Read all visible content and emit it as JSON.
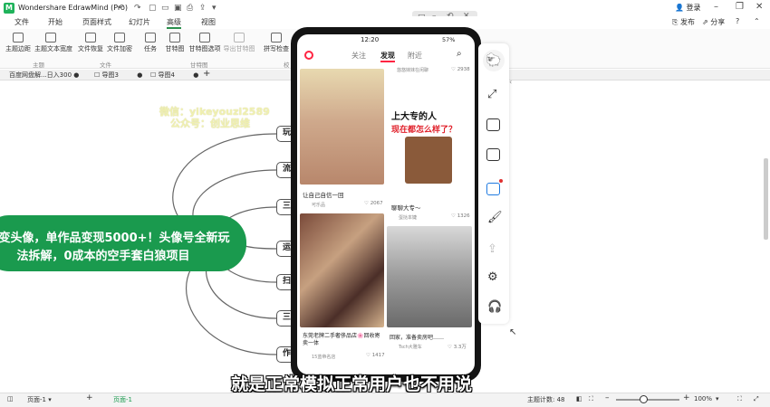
{
  "app": {
    "title": "Wondershare EdrawMind (Pro)",
    "logo": "M",
    "login": "登录",
    "publish": "发布",
    "share": "分享"
  },
  "menu": [
    "文件",
    "开始",
    "页面样式",
    "幻灯片",
    "高级",
    "视图"
  ],
  "ribbon": {
    "buttons": [
      "主题边距",
      "主题文本宽度",
      "文件恢复",
      "文件加密",
      "任务",
      "甘特图",
      "甘特图选项",
      "导出甘特图",
      "拼写检查"
    ],
    "groups": [
      "主题",
      "文件",
      "甘特图",
      "校"
    ]
  },
  "doc_tabs": [
    "百度网盘解...日入300",
    "导图3",
    "导图4"
  ],
  "watermark": {
    "line1": "微信：yikeyouzi2589",
    "line2": "公众号：创业思维"
  },
  "central_topic": {
    "line1": "变头像，单作品变现5000+！头像号全新玩",
    "line2": "法拆解，0成本的空手套白狼项目"
  },
  "branches": [
    "玩",
    "流",
    "三",
    "运",
    "扫",
    "三",
    "作"
  ],
  "phone": {
    "time": "12:20",
    "battery": "57%",
    "tabs": [
      "关注",
      "发现",
      "附近"
    ],
    "active_tab": "发现",
    "top_left_user": "悠悠妹妹在闲聊",
    "top_right_likes": "2938",
    "card1": {
      "title": "让自己自信一回",
      "user": "可乐品",
      "likes": "2067"
    },
    "card2": {
      "title_top": "上大专的人",
      "title_bottom": "现在都怎么样了？",
      "caption": "聊聊大专～",
      "user": "蛋挞本婕",
      "likes": "1326"
    },
    "card3": {
      "title": "东莞老牌二手奢侈品店🌸回收寄卖一体",
      "user": "15蓝帝名店",
      "likes": "1417"
    },
    "card4": {
      "title": "回家，准备卖房吧……",
      "user": "Tsch大雅车",
      "likes": "3.3万"
    }
  },
  "subtitle": "就是正常模拟正常用户也不用说",
  "status": {
    "page_selector": "页面-1",
    "page_tab": "页面-1",
    "topic_count_label": "主题计数:",
    "topic_count": "48",
    "zoom": "100%"
  },
  "colors": {
    "brand": "#1a9a4e",
    "central": "#1a9a4e",
    "xhs_red": "#ff2442"
  }
}
